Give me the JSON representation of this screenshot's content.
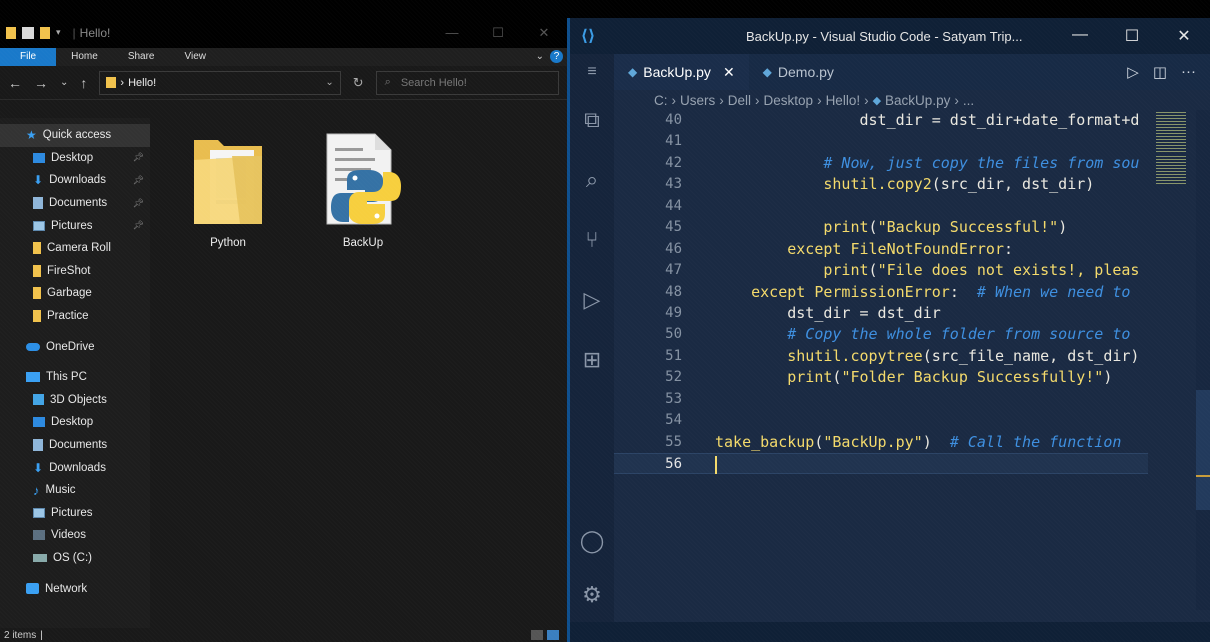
{
  "explorer": {
    "title": "Hello!",
    "ribbon_tabs": [
      "File",
      "Home",
      "Share",
      "View"
    ],
    "address": {
      "path_segment": "Hello!",
      "search_placeholder": "Search Hello!"
    },
    "nav": {
      "quick_access": "Quick access",
      "pinned": [
        "Desktop",
        "Downloads",
        "Documents",
        "Pictures"
      ],
      "folders": [
        "Camera Roll",
        "FireShot",
        "Garbage",
        "Practice"
      ],
      "onedrive": "OneDrive",
      "this_pc": "This PC",
      "pc_items": [
        "3D Objects",
        "Desktop",
        "Documents",
        "Downloads",
        "Music",
        "Pictures",
        "Videos",
        "OS (C:)"
      ],
      "network": "Network"
    },
    "files": [
      {
        "name": "Python",
        "type": "folder"
      },
      {
        "name": "BackUp",
        "type": "python-file"
      }
    ],
    "status": "2 items"
  },
  "vscode": {
    "title": "BackUp.py - Visual Studio Code - Satyam Trip...",
    "tabs": [
      {
        "label": "BackUp.py",
        "active": true
      },
      {
        "label": "Demo.py",
        "active": false
      }
    ],
    "breadcrumb": [
      "C:",
      "Users",
      "Dell",
      "Desktop",
      "Hello!",
      "BackUp.py",
      "..."
    ],
    "lines": [
      {
        "n": "40",
        "code": "                dst_dir = dst_dir+date_format+d"
      },
      {
        "n": "41",
        "code": ""
      },
      {
        "n": "42",
        "code": "            # Now, just copy the files from sou"
      },
      {
        "n": "43",
        "code": "            shutil.copy2(src_dir, dst_dir)"
      },
      {
        "n": "44",
        "code": ""
      },
      {
        "n": "45",
        "code": "            print(\"Backup Successful!\")"
      },
      {
        "n": "46",
        "code": "        except FileNotFoundError:"
      },
      {
        "n": "47",
        "code": "            print(\"File does not exists!, pleas"
      },
      {
        "n": "48",
        "code": "    except PermissionError:  # When we need to"
      },
      {
        "n": "49",
        "code": "        dst_dir = dst_dir"
      },
      {
        "n": "50",
        "code": "        # Copy the whole folder from source to"
      },
      {
        "n": "51",
        "code": "        shutil.copytree(src_file_name, dst_dir)"
      },
      {
        "n": "52",
        "code": "        print(\"Folder Backup Successfully!\")"
      },
      {
        "n": "53",
        "code": ""
      },
      {
        "n": "54",
        "code": ""
      },
      {
        "n": "55",
        "code": "take_backup(\"BackUp.py\")  # Call the function"
      },
      {
        "n": "56",
        "code": ""
      }
    ],
    "current_line": "56"
  },
  "colors": {
    "explorer_bg": "#191919",
    "vscode_bg": "#1a2a43",
    "accent_blue": "#1979ca",
    "code_yellow": "#f4da6b",
    "comment_blue": "#3e8fe0"
  }
}
